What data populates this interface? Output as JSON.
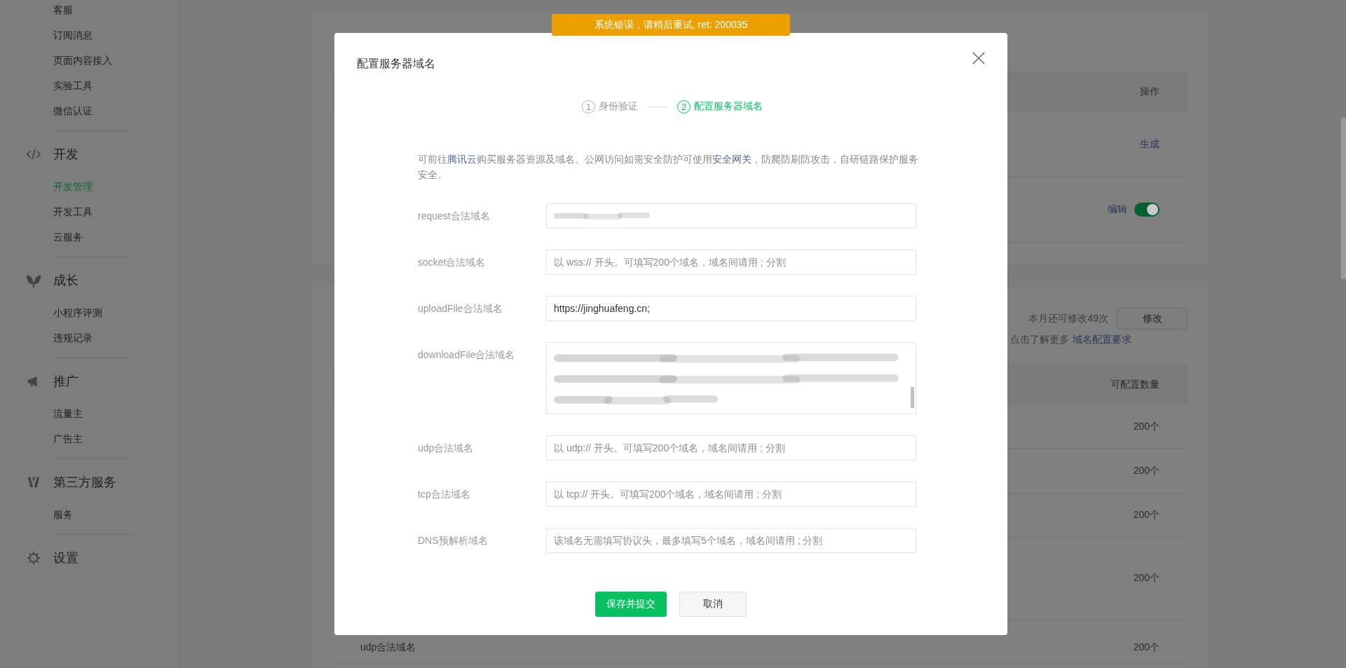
{
  "toast": {
    "message": "系统错误，请稍后重试, ret: 200035"
  },
  "sidebar": {
    "groups": [
      {
        "items": [
          {
            "label": "客服",
            "selected": false
          },
          {
            "label": "订阅消息",
            "selected": false
          },
          {
            "label": "页面内容接入",
            "selected": false
          },
          {
            "label": "实验工具",
            "selected": false
          },
          {
            "label": "微信认证",
            "selected": false
          }
        ]
      },
      {
        "title": "开发",
        "kind": "code",
        "items": [
          {
            "label": "开发管理",
            "selected": true
          },
          {
            "label": "开发工具",
            "selected": false
          },
          {
            "label": "云服务",
            "selected": false
          }
        ]
      },
      {
        "title": "成长",
        "kind": "sprout",
        "items": [
          {
            "label": "小程序评测",
            "selected": false
          },
          {
            "label": "违规记录",
            "selected": false
          }
        ]
      },
      {
        "title": "推广",
        "kind": "megaphone",
        "items": [
          {
            "label": "流量主",
            "selected": false
          },
          {
            "label": "广告主",
            "selected": false
          }
        ]
      },
      {
        "title": "第三方服务",
        "kind": "third-party",
        "items": [
          {
            "label": "服务",
            "selected": false
          }
        ]
      },
      {
        "title": "设置",
        "kind": "gear"
      }
    ]
  },
  "background": {
    "card_1": {
      "table": {
        "columns": [
          "操作"
        ],
        "rows": [
          {
            "kind": "link",
            "action": "生成"
          },
          {
            "kind": "toggle",
            "action": "编辑",
            "on": true
          }
        ]
      }
    },
    "card_2": {
      "quota": "本月还可修改49次",
      "modify_button": "修改",
      "hint": "点击了解更多",
      "hint_link": "域名配置要求",
      "table": {
        "columns": [
          "可配置数量"
        ],
        "rows": [
          {
            "count": "200个"
          },
          {
            "count": "200个"
          },
          {
            "count": "200个"
          },
          {
            "count": "200个"
          },
          {
            "name": "udp合法域名",
            "count": "200个"
          }
        ]
      }
    }
  },
  "dialog": {
    "title": "配置服务器域名",
    "steps": [
      {
        "number": "1",
        "label": "身份验证",
        "selected": false
      },
      {
        "number": "2",
        "label": "配置服务器域名",
        "selected": true
      }
    ],
    "description": [
      {
        "kind": "text",
        "text": "可前往"
      },
      {
        "kind": "link",
        "text": "腾讯云"
      },
      {
        "kind": "text",
        "text": "购买服务器资源及域名。公网访问如需安全防护可使用"
      },
      {
        "kind": "link",
        "text": "安全网关"
      },
      {
        "kind": "text",
        "text": "，防爬防刷防攻击，自研链路保护服务安全。"
      }
    ],
    "fields": [
      {
        "label": "request合法域名",
        "kind": "redacted"
      },
      {
        "label": "socket合法域名",
        "kind": "input",
        "placeholder": "以 wss:// 开头。可填写200个域名，域名间请用 ; 分割"
      },
      {
        "label": "uploadFile合法域名",
        "kind": "input",
        "value": "https://jinghuafeng.cn;"
      },
      {
        "label": "downloadFile合法域名",
        "kind": "redacted-multiline"
      },
      {
        "label": "udp合法域名",
        "kind": "input",
        "placeholder": "以 udp:// 开头。可填写200个域名，域名间请用 ; 分割"
      },
      {
        "label": "tcp合法域名",
        "kind": "input",
        "placeholder": "以 tcp:// 开头。可填写200个域名，域名间请用 ; 分割"
      },
      {
        "label": "DNS预解析域名",
        "kind": "input",
        "placeholder": "该域名无需填写协议头，最多填写5个域名，域名间请用 ; 分割"
      }
    ],
    "buttons": [
      {
        "label": "保存并提交",
        "kind": "primary"
      },
      {
        "label": "取消",
        "kind": "default"
      }
    ]
  }
}
